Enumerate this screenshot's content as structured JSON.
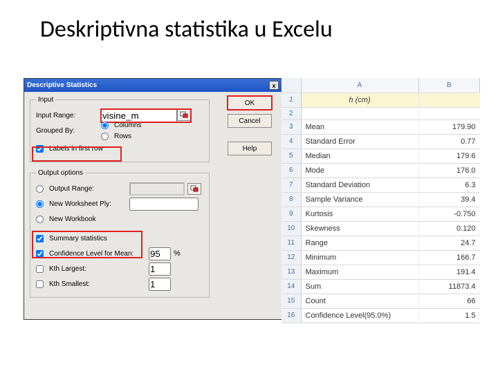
{
  "slide": {
    "title": "Deskriptivna statistika u Excelu"
  },
  "dialog": {
    "title": "Descriptive Statistics",
    "close_icon": "x",
    "buttons": {
      "ok": "OK",
      "cancel": "Cancel",
      "help": "Help"
    },
    "input": {
      "legend": "Input",
      "input_range_label": "Input Range:",
      "input_range_value": "visine_m",
      "grouped_by_label": "Grouped By:",
      "columns_label": "Columns",
      "rows_label": "Rows",
      "labels_first_row_label": "Labels in first row"
    },
    "output": {
      "legend": "Output options",
      "output_range_label": "Output Range:",
      "new_worksheet_label": "New Worksheet Ply:",
      "new_worksheet_value": "",
      "new_workbook_label": "New Workbook",
      "summary_label": "Summary statistics",
      "confidence_label": "Confidence Level for Mean:",
      "confidence_value": "95",
      "confidence_unit": "%",
      "kth_largest_label": "Kth Largest:",
      "kth_largest_value": "1",
      "kth_smallest_label": "Kth Smallest:",
      "kth_smallest_value": "1"
    }
  },
  "sheet": {
    "col_headers": {
      "A": "A",
      "B": "B"
    },
    "header_cell": "h (cm)",
    "rows": [
      {
        "n": "1",
        "A": "",
        "B": ""
      },
      {
        "n": "2",
        "A": "",
        "B": ""
      },
      {
        "n": "3",
        "A": "Mean",
        "B": "179.90"
      },
      {
        "n": "4",
        "A": "Standard Error",
        "B": "0.77"
      },
      {
        "n": "5",
        "A": "Median",
        "B": "179.6"
      },
      {
        "n": "6",
        "A": "Mode",
        "B": "176.0"
      },
      {
        "n": "7",
        "A": "Standard Deviation",
        "B": "6.3"
      },
      {
        "n": "8",
        "A": "Sample Variance",
        "B": "39.4"
      },
      {
        "n": "9",
        "A": "Kurtosis",
        "B": "-0.750"
      },
      {
        "n": "10",
        "A": "Skewness",
        "B": "0.120"
      },
      {
        "n": "11",
        "A": "Range",
        "B": "24.7"
      },
      {
        "n": "12",
        "A": "Minimum",
        "B": "166.7"
      },
      {
        "n": "13",
        "A": "Maximum",
        "B": "191.4"
      },
      {
        "n": "14",
        "A": "Sum",
        "B": "11873.4"
      },
      {
        "n": "15",
        "A": "Count",
        "B": "66"
      },
      {
        "n": "16",
        "A": "Confidence Level(95.0%)",
        "B": "1.5"
      }
    ]
  }
}
